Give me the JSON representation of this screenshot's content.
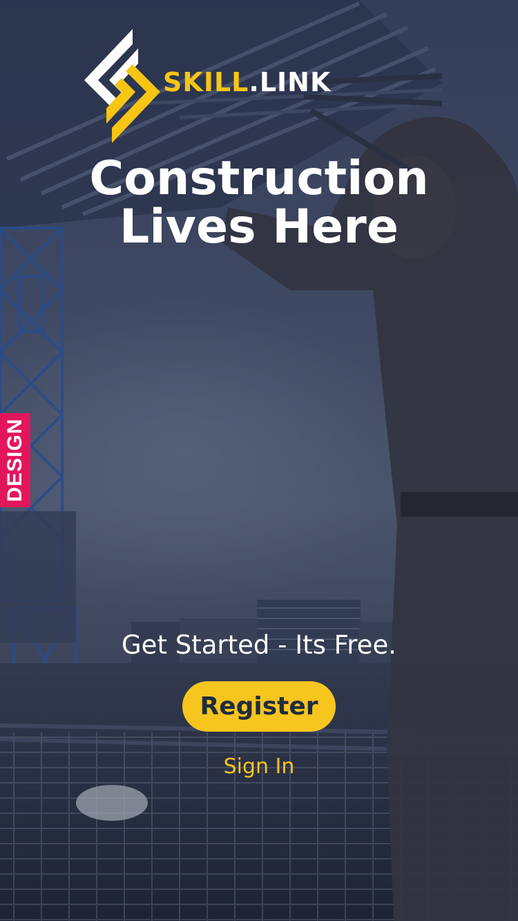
{
  "brand": {
    "name_part1": "SKILL",
    "name_part2": ".LINK",
    "accent_color": "#f6c51e"
  },
  "hero": {
    "headline_line1": "Construction",
    "headline_line2": "Lives Here",
    "background_image": "construction-worker-lifting-rebar-photo"
  },
  "cta": {
    "tagline": "Get Started - Its Free.",
    "register_label": "Register",
    "signin_label": "Sign In"
  },
  "side_tab": {
    "label": "DESIGN",
    "color": "#e3165b"
  }
}
